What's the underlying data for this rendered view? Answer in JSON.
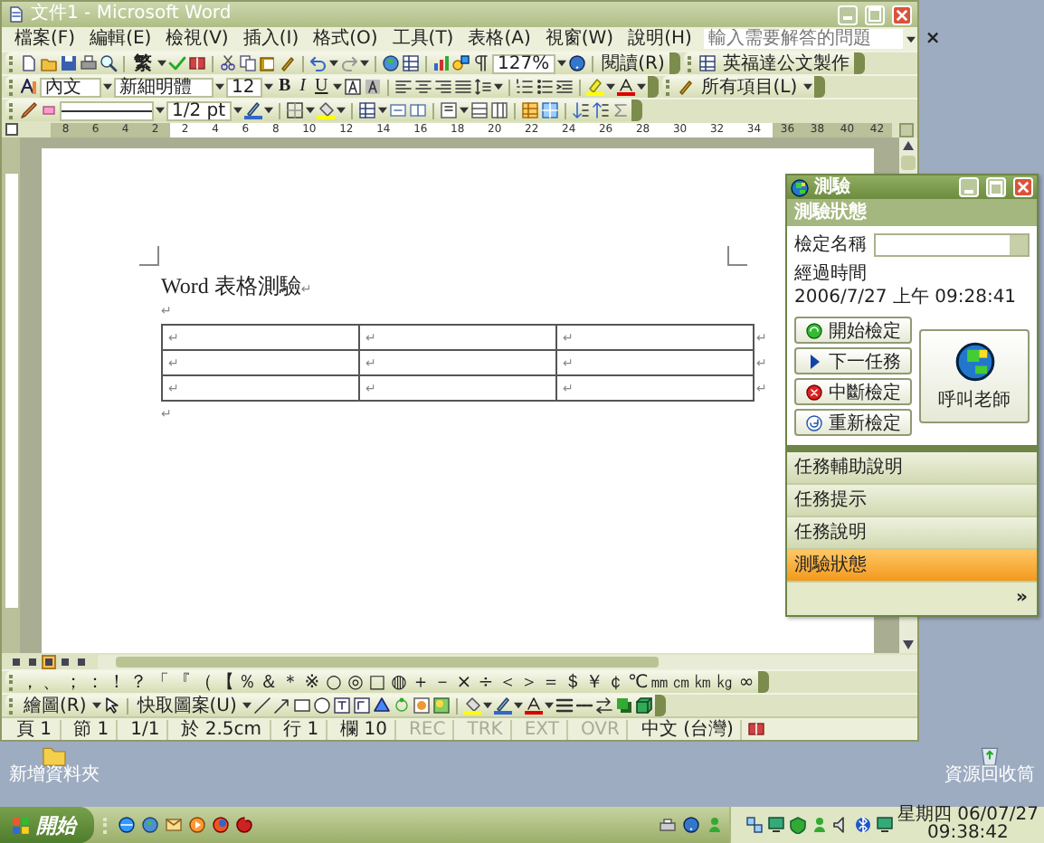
{
  "window": {
    "title": "文件1 - Microsoft Word"
  },
  "menu": {
    "items": [
      "檔案(F)",
      "編輯(E)",
      "檢視(V)",
      "插入(I)",
      "格式(O)",
      "工具(T)",
      "表格(A)",
      "視窗(W)",
      "說明(H)"
    ],
    "help_box": {
      "placeholder": "輸入需要解答的問題"
    },
    "close_doc": "×"
  },
  "standard_toolbar": {
    "convert_button": "繁",
    "zoom": "127%",
    "read_button": "閱讀(R)",
    "addin_button": "英福達公文製作"
  },
  "formatting_toolbar": {
    "style": "內文",
    "font": "新細明體",
    "size": "12",
    "format_buttons": [
      "B",
      "I",
      "U"
    ],
    "task_pane": "所有項目(L)"
  },
  "tables_toolbar": {
    "line_weight": "1/2 pt"
  },
  "ruler": {
    "left_labels": [
      "8",
      "6",
      "4",
      "2"
    ],
    "labels": [
      "2",
      "4",
      "6",
      "8",
      "10",
      "12",
      "14",
      "16",
      "18",
      "20",
      "22",
      "24",
      "26",
      "28",
      "30",
      "32",
      "34"
    ],
    "right_labels": [
      "36",
      "38",
      "40",
      "42"
    ]
  },
  "document": {
    "heading": "Word 表格測驗",
    "heading_mark": "↵",
    "paragraphs_before": [
      "↵"
    ],
    "table": {
      "rows": [
        {
          "cells": [
            "↵",
            "↵",
            "↵"
          ],
          "end_mark": "↵"
        },
        {
          "cells": [
            "↵",
            "↵",
            "↵"
          ],
          "end_mark": "↵"
        },
        {
          "cells": [
            "↵",
            "↵",
            "↵"
          ],
          "end_mark": "↵"
        }
      ]
    },
    "paragraphs_after": [
      "↵"
    ]
  },
  "view_buttons": [
    {
      "selected": false
    },
    {
      "selected": false
    },
    {
      "selected": true
    },
    {
      "selected": false
    },
    {
      "selected": false
    }
  ],
  "symbol_toolbar": {
    "symbols": [
      "，",
      "、",
      "；",
      "：",
      "！",
      "？",
      "「",
      "『",
      "（",
      "【",
      "％",
      "＆",
      "＊",
      "※",
      "○",
      "◎",
      "□",
      "◍",
      "＋",
      "－",
      "×",
      "÷",
      "＜",
      "＞",
      "＝",
      "＄",
      "￥",
      "￠",
      "℃",
      "㎜",
      "㎝",
      "㎞",
      "㎏",
      "∞"
    ]
  },
  "drawing_toolbar": {
    "draw_menu": "繪圖(R)",
    "autoshapes_menu": "快取圖案(U)"
  },
  "status_bar": {
    "fields": [
      {
        "text": "頁 1",
        "disabled": false
      },
      {
        "text": "節 1",
        "disabled": false
      },
      {
        "text": "1/1",
        "disabled": false
      },
      {
        "text": "於 2.5cm",
        "disabled": false
      },
      {
        "text": "行 1",
        "disabled": false
      },
      {
        "text": "欄 10",
        "disabled": false
      },
      {
        "text": "REC",
        "disabled": true
      },
      {
        "text": "TRK",
        "disabled": true
      },
      {
        "text": "EXT",
        "disabled": true
      },
      {
        "text": "OVR",
        "disabled": true
      },
      {
        "text": "中文 (台灣)",
        "disabled": false
      }
    ]
  },
  "task_panel": {
    "title": "測驗",
    "header": "測驗狀態",
    "exam_name_label": "檢定名稱",
    "elapsed_label": "經過時間",
    "elapsed_value": "2006/7/27 上午 09:28:41",
    "buttons": [
      {
        "label": "開始檢定",
        "kind": "start"
      },
      {
        "label": "下一任務",
        "kind": "next"
      },
      {
        "label": "中斷檢定",
        "kind": "stop"
      },
      {
        "label": "重新檢定",
        "kind": "restart"
      }
    ],
    "call_button": "呼叫老師",
    "sections": [
      {
        "label": "任務輔助說明",
        "selected": false
      },
      {
        "label": "任務提示",
        "selected": false
      },
      {
        "label": "任務說明",
        "selected": false
      },
      {
        "label": "測驗狀態",
        "selected": true
      }
    ],
    "more": "»"
  },
  "desktop_icons": [
    {
      "label": "新增資料夾",
      "kind": "folder"
    },
    {
      "label": "資源回收筒",
      "kind": "recycle"
    }
  ],
  "taskbar": {
    "start": "開始",
    "clock_day": "星期四 06/07/27",
    "clock_time": "09:38:42"
  }
}
